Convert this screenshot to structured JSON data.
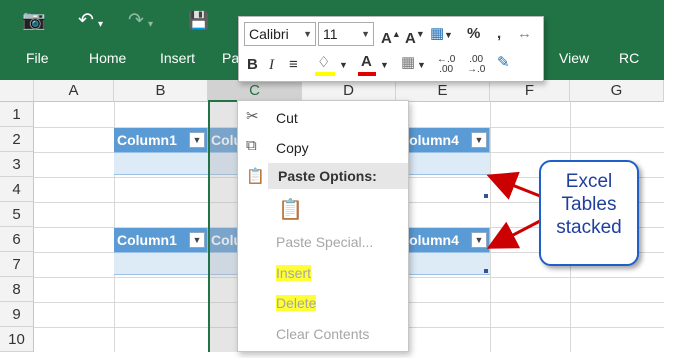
{
  "ribbon": {
    "color": "#217346",
    "tabs": [
      "File",
      "Home",
      "Insert",
      "Pa",
      "View",
      "RC"
    ]
  },
  "mini_toolbar": {
    "font_name": "Calibri",
    "font_size": "11",
    "fill_color": "#ffff00",
    "font_color": "#e00000"
  },
  "sheet": {
    "columns": [
      "A",
      "B",
      "C",
      "D",
      "E",
      "F",
      "G"
    ],
    "rows": [
      "1",
      "2",
      "3",
      "4",
      "5",
      "6",
      "7",
      "8",
      "9",
      "10"
    ],
    "selected_column": "C"
  },
  "tables": {
    "header_color": "#5b9bd5",
    "band_color": "#ddebf7",
    "headers": {
      "b": "Column1",
      "c": "Colu",
      "e": "Column4"
    }
  },
  "context_menu": {
    "cut": "Cut",
    "copy": "Copy",
    "paste_options": "Paste Options:",
    "paste_special": "Paste Special...",
    "insert": "Insert",
    "delete": "Delete",
    "clear_contents": "Clear Contents"
  },
  "callout": {
    "lines": [
      "Excel",
      "Tables",
      "stacked"
    ],
    "color": "#1f5fc8"
  },
  "annotation_arrow_color": "#cc0000"
}
